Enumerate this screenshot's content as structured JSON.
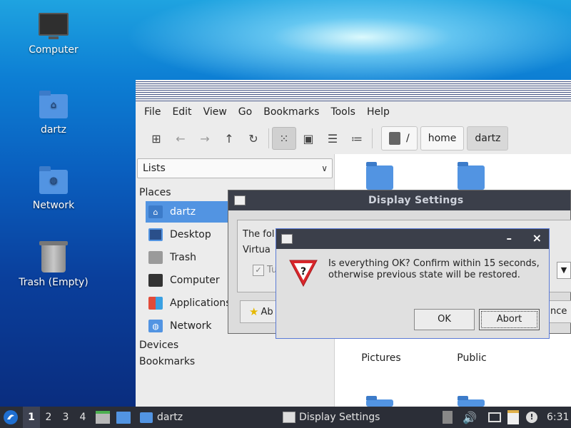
{
  "desktop": {
    "icons": [
      {
        "label": "Computer"
      },
      {
        "label": "dartz"
      },
      {
        "label": "Network"
      },
      {
        "label": "Trash (Empty)"
      }
    ]
  },
  "file_manager": {
    "menu": [
      "File",
      "Edit",
      "View",
      "Go",
      "Bookmarks",
      "Tools",
      "Help"
    ],
    "breadcrumbs": [
      "/",
      "home",
      "dartz"
    ],
    "side_mode": "Lists",
    "places_header": "Places",
    "places": [
      "dartz",
      "Desktop",
      "Trash",
      "Computer",
      "Applications",
      "Network"
    ],
    "devices_header": "Devices",
    "bookmarks_header": "Bookmarks",
    "content_folders": [
      "Pictures",
      "Public"
    ]
  },
  "display_settings": {
    "title": "Display Settings",
    "text_partial": "The fol",
    "group_partial": "Virtua",
    "check_partial": "Tu",
    "about_partial": "Ab",
    "cancel_partial": "ance"
  },
  "confirm": {
    "message": "Is everything OK? Confirm within 15 seconds, otherwise previous state will be restored.",
    "ok_label": "OK",
    "abort_label": "Abort",
    "minimize_glyph": "–",
    "close_glyph": "×"
  },
  "taskbar": {
    "workspaces": [
      "1",
      "2",
      "3",
      "4"
    ],
    "current_workspace": "1",
    "windows": [
      "dartz",
      "Display Settings"
    ],
    "clock": "6:31"
  },
  "colors": {
    "accent": "#5294e2",
    "titlebar": "#3b3f4a",
    "taskbar": "#2b2e37"
  }
}
